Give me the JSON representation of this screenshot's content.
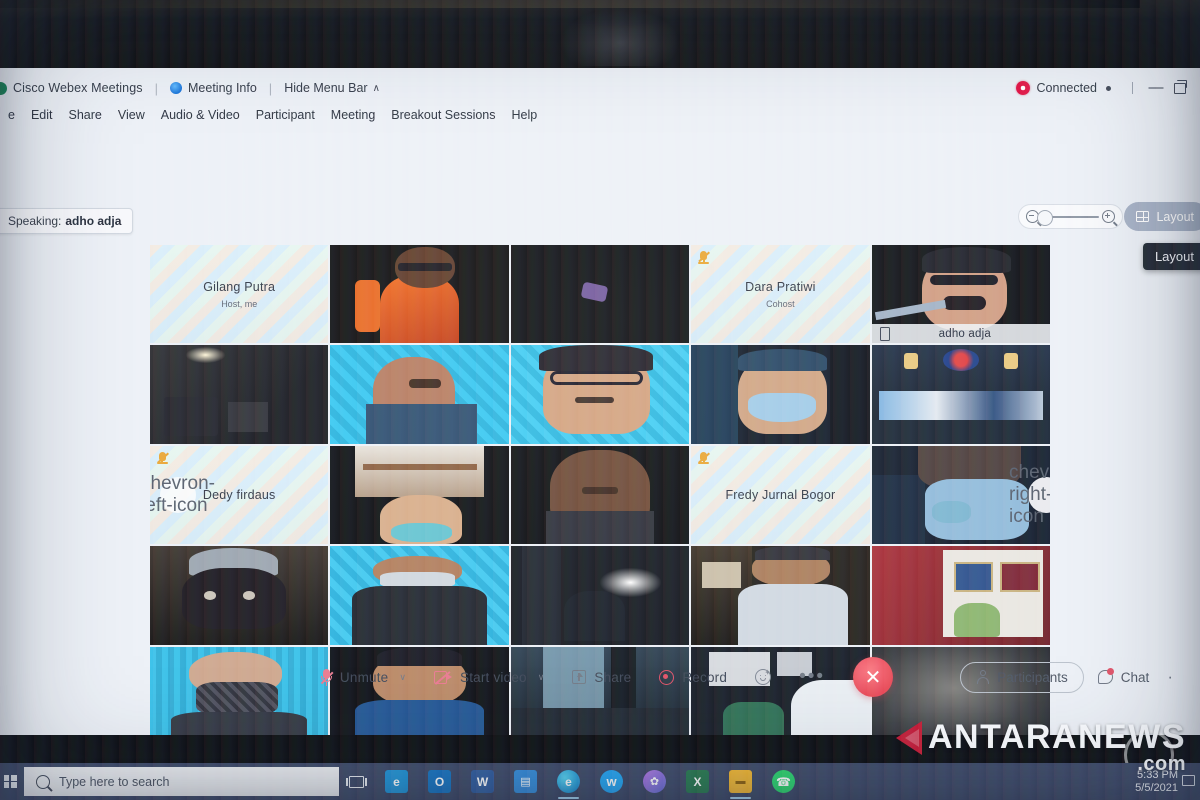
{
  "app": {
    "name": "Cisco Webex Meetings",
    "logo_icon": "webex-logo-icon",
    "meeting_info": "Meeting Info",
    "meeting_info_icon": "info-circle-icon",
    "hide_menu_bar": "Hide Menu Bar",
    "hide_menu_caret": "∧",
    "connection_status": "Connected",
    "connection_icon": "recording-status-icon",
    "minimize_label": "–",
    "restore_label": "restore-window-icon"
  },
  "menu": {
    "items": [
      {
        "label": "e",
        "mnemonic": ""
      },
      {
        "label": "Edit",
        "mnemonic": "E"
      },
      {
        "label": "Share",
        "mnemonic": "S"
      },
      {
        "label": "View",
        "mnemonic": "V"
      },
      {
        "label": "Audio & Video",
        "mnemonic": "A"
      },
      {
        "label": "Participant",
        "mnemonic": "P"
      },
      {
        "label": "Meeting",
        "mnemonic": "M"
      },
      {
        "label": "Breakout Sessions",
        "mnemonic": "B"
      },
      {
        "label": "Help",
        "mnemonic": "H"
      }
    ]
  },
  "stage": {
    "speaking_prefix": "Speaking:",
    "speaking_name": "adho adja",
    "zoom_out_icon": "zoom-out-icon",
    "zoom_in_icon": "zoom-in-icon",
    "zoom_slider_value": "0",
    "layout_label": "Layout",
    "layout_icon": "grid-layout-icon",
    "layout_tooltip": "Layout",
    "prev_page_icon": "chevron-left-icon",
    "next_page_icon": "chevron-right-icon"
  },
  "grid": {
    "columns": 5,
    "rows": 5,
    "tiles": [
      {
        "id": "t1",
        "type": "placeholder",
        "name": "Gilang Putra",
        "role": "Host, me",
        "muted": false,
        "active": false
      },
      {
        "id": "t2",
        "type": "video",
        "name": "",
        "role": "",
        "muted": false,
        "active": false
      },
      {
        "id": "t3",
        "type": "video",
        "name": "",
        "role": "",
        "muted": false,
        "active": false
      },
      {
        "id": "t4",
        "type": "placeholder",
        "name": "Dara Pratiwi",
        "role": "Cohost",
        "muted": true,
        "active": false
      },
      {
        "id": "t5",
        "type": "video",
        "name": "adho adja",
        "role": "",
        "muted": false,
        "active": true
      },
      {
        "id": "t6",
        "type": "video",
        "name": "",
        "role": "",
        "muted": false,
        "active": false
      },
      {
        "id": "t7",
        "type": "video",
        "name": "",
        "role": "",
        "muted": false,
        "active": false
      },
      {
        "id": "t8",
        "type": "video",
        "name": "",
        "role": "",
        "muted": false,
        "active": false
      },
      {
        "id": "t9",
        "type": "video",
        "name": "",
        "role": "",
        "muted": false,
        "active": false
      },
      {
        "id": "t10",
        "type": "video",
        "name": "",
        "role": "",
        "muted": false,
        "active": false
      },
      {
        "id": "t11",
        "type": "placeholder",
        "name": "Dedy firdaus",
        "role": "",
        "muted": true,
        "active": false
      },
      {
        "id": "t12",
        "type": "video",
        "name": "",
        "role": "",
        "muted": false,
        "active": false
      },
      {
        "id": "t13",
        "type": "video",
        "name": "",
        "role": "",
        "muted": false,
        "active": false
      },
      {
        "id": "t14",
        "type": "placeholder",
        "name": "Fredy Jurnal Bogor",
        "role": "",
        "muted": true,
        "active": false
      },
      {
        "id": "t15",
        "type": "video",
        "name": "",
        "role": "",
        "muted": false,
        "active": false
      },
      {
        "id": "t16",
        "type": "video",
        "name": "",
        "role": "",
        "muted": false,
        "active": false
      },
      {
        "id": "t17",
        "type": "video",
        "name": "",
        "role": "",
        "muted": false,
        "active": false
      },
      {
        "id": "t18",
        "type": "video",
        "name": "",
        "role": "",
        "muted": false,
        "active": false
      },
      {
        "id": "t19",
        "type": "video",
        "name": "",
        "role": "",
        "muted": false,
        "active": false
      },
      {
        "id": "t20",
        "type": "video",
        "name": "",
        "role": "",
        "muted": false,
        "active": false
      },
      {
        "id": "t21",
        "type": "video",
        "name": "",
        "role": "",
        "muted": false,
        "active": false
      },
      {
        "id": "t22",
        "type": "video",
        "name": "",
        "role": "",
        "muted": false,
        "active": false
      },
      {
        "id": "t23",
        "type": "video",
        "name": "",
        "role": "",
        "muted": false,
        "active": false
      },
      {
        "id": "t24",
        "type": "video",
        "name": "",
        "role": "",
        "muted": false,
        "active": false
      },
      {
        "id": "t25",
        "type": "video",
        "name": "",
        "role": "",
        "muted": false,
        "active": false
      }
    ]
  },
  "controls": {
    "mute_label": "Unmute",
    "mute_icon": "mic-muted-icon",
    "mute_caret": "∨",
    "video_label": "Start video",
    "video_icon": "camera-off-icon",
    "video_caret": "∨",
    "share_label": "Share",
    "share_icon": "share-screen-icon",
    "record_label": "Record",
    "record_icon": "record-circle-icon",
    "reactions_icon": "reactions-smiley-icon",
    "more_label": "•••",
    "more_icon": "more-options-icon",
    "leave_label": "✕",
    "leave_icon": "end-meeting-icon",
    "participants_label": "Participants",
    "participants_icon": "person-icon",
    "chat_label": "Chat",
    "chat_icon": "chat-bubble-icon",
    "chat_has_notification": true,
    "right_more": "·"
  },
  "taskbar": {
    "start_icon": "windows-start-icon",
    "search_placeholder": "Type here to search",
    "search_icon": "search-icon",
    "task_view_icon": "task-view-icon",
    "apps": [
      {
        "name": "internet-explorer-icon",
        "glyph": "e",
        "bg": "#1a8fd4",
        "fg": "#ffffff",
        "open": false
      },
      {
        "name": "outlook-icon",
        "glyph": "O",
        "bg": "#0f6cbd",
        "fg": "#ffffff",
        "open": false
      },
      {
        "name": "word-icon",
        "glyph": "W",
        "bg": "#2b579a",
        "fg": "#ffffff",
        "open": false
      },
      {
        "name": "news-icon",
        "glyph": "▤",
        "bg": "#2e86d8",
        "fg": "#ffffff",
        "open": false
      },
      {
        "name": "microsoft-edge-icon",
        "glyph": "e",
        "bg": "#1a9ae0",
        "fg": "#ffffff",
        "open": true
      },
      {
        "name": "twitter-icon",
        "glyph": "ᴠ",
        "bg": "#1da1f2",
        "fg": "#ffffff",
        "open": false
      },
      {
        "name": "paint-3d-icon",
        "glyph": "✿",
        "bg": "#7a4fd6",
        "fg": "#ffffff",
        "open": false
      },
      {
        "name": "excel-icon",
        "glyph": "X",
        "bg": "#217346",
        "fg": "#ffffff",
        "open": false
      },
      {
        "name": "file-explorer-icon",
        "glyph": "▬",
        "bg": "#f0b429",
        "fg": "#8a5a00",
        "open": true
      },
      {
        "name": "whatsapp-icon",
        "glyph": "✆",
        "bg": "#25d366",
        "fg": "#ffffff",
        "open": false
      }
    ],
    "time": "5:33 PM",
    "date": "5/5/2021",
    "notification_icon": "action-center-icon"
  },
  "watermark": {
    "brand": "ANTARANEWS",
    "suffix": ".com",
    "logo_icon": "antaranews-triangle-icon"
  }
}
